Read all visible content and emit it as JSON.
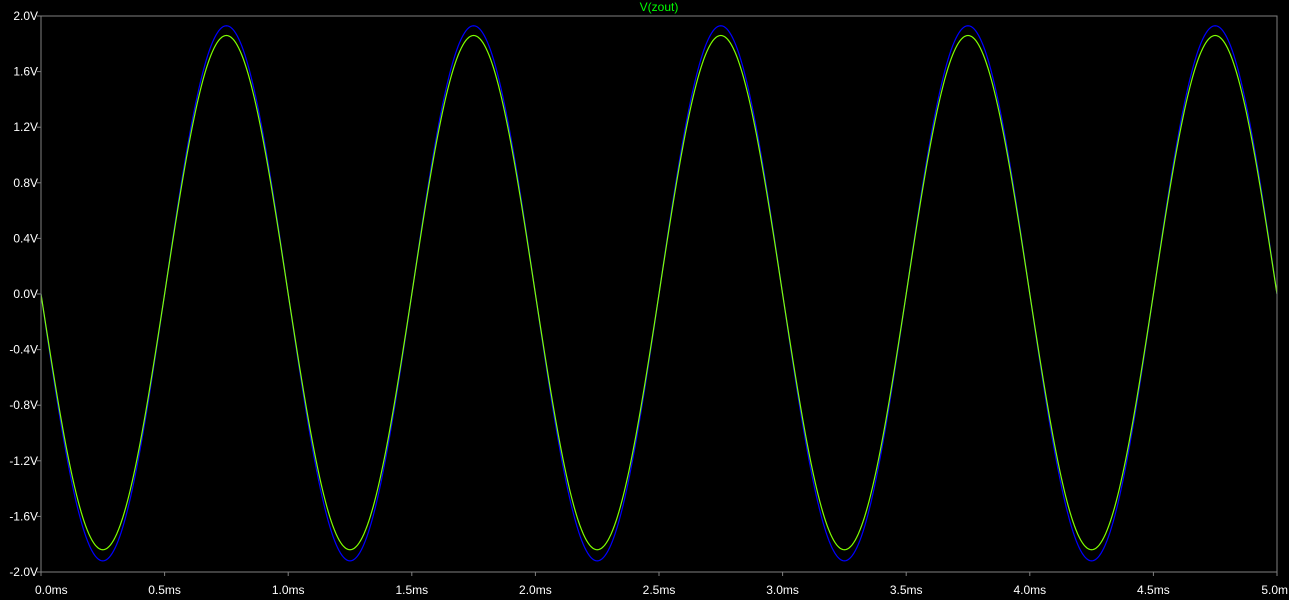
{
  "chart_data": {
    "type": "line",
    "title": "V(zout)",
    "xlabel": "",
    "ylabel": "",
    "xlim": [
      0.0,
      5.0
    ],
    "ylim": [
      -2.0,
      2.0
    ],
    "x_tick_labels": [
      "0.0ms",
      "0.5ms",
      "1.0ms",
      "1.5ms",
      "2.0ms",
      "2.5ms",
      "3.0ms",
      "3.5ms",
      "4.0ms",
      "4.5ms",
      "5.0m"
    ],
    "y_tick_labels": [
      "2.0V",
      "1.6V",
      "1.2V",
      "0.8V",
      "0.4V",
      "0.0V",
      "-0.4V",
      "-0.8V",
      "-1.2V",
      "-1.6V",
      "-2.0V"
    ],
    "grid": false,
    "legend": "none",
    "series": [
      {
        "color": "#0000ff",
        "x": [
          0.0,
          0.25,
          0.5,
          0.75,
          1.0,
          1.25,
          1.5,
          1.75,
          2.0,
          2.25,
          2.5,
          2.75,
          3.0,
          3.25,
          3.5,
          3.75,
          4.0,
          4.25,
          4.5,
          4.75,
          5.0
        ],
        "y": [
          0.0,
          -1.92,
          0.0,
          1.93,
          0.0,
          -1.92,
          0.0,
          1.93,
          0.0,
          -1.92,
          0.0,
          1.93,
          0.0,
          -1.92,
          0.0,
          1.93,
          0.0,
          -1.92,
          0.0,
          1.93,
          0.0
        ]
      },
      {
        "color": "#7fff00",
        "x": [
          0.0,
          0.25,
          0.5,
          0.75,
          1.0,
          1.25,
          1.5,
          1.75,
          2.0,
          2.25,
          2.5,
          2.75,
          3.0,
          3.25,
          3.5,
          3.75,
          4.0,
          4.25,
          4.5,
          4.75,
          5.0
        ],
        "y": [
          0.0,
          -1.84,
          0.0,
          1.86,
          0.0,
          -1.84,
          0.0,
          1.86,
          0.0,
          -1.84,
          0.0,
          1.86,
          0.0,
          -1.84,
          0.0,
          1.86,
          0.0,
          -1.84,
          0.0,
          1.86,
          0.0
        ]
      }
    ],
    "colors": {
      "background": "#000000",
      "axis": "#808080",
      "tick_text": "#ffffff",
      "title": "#00ff00"
    }
  }
}
